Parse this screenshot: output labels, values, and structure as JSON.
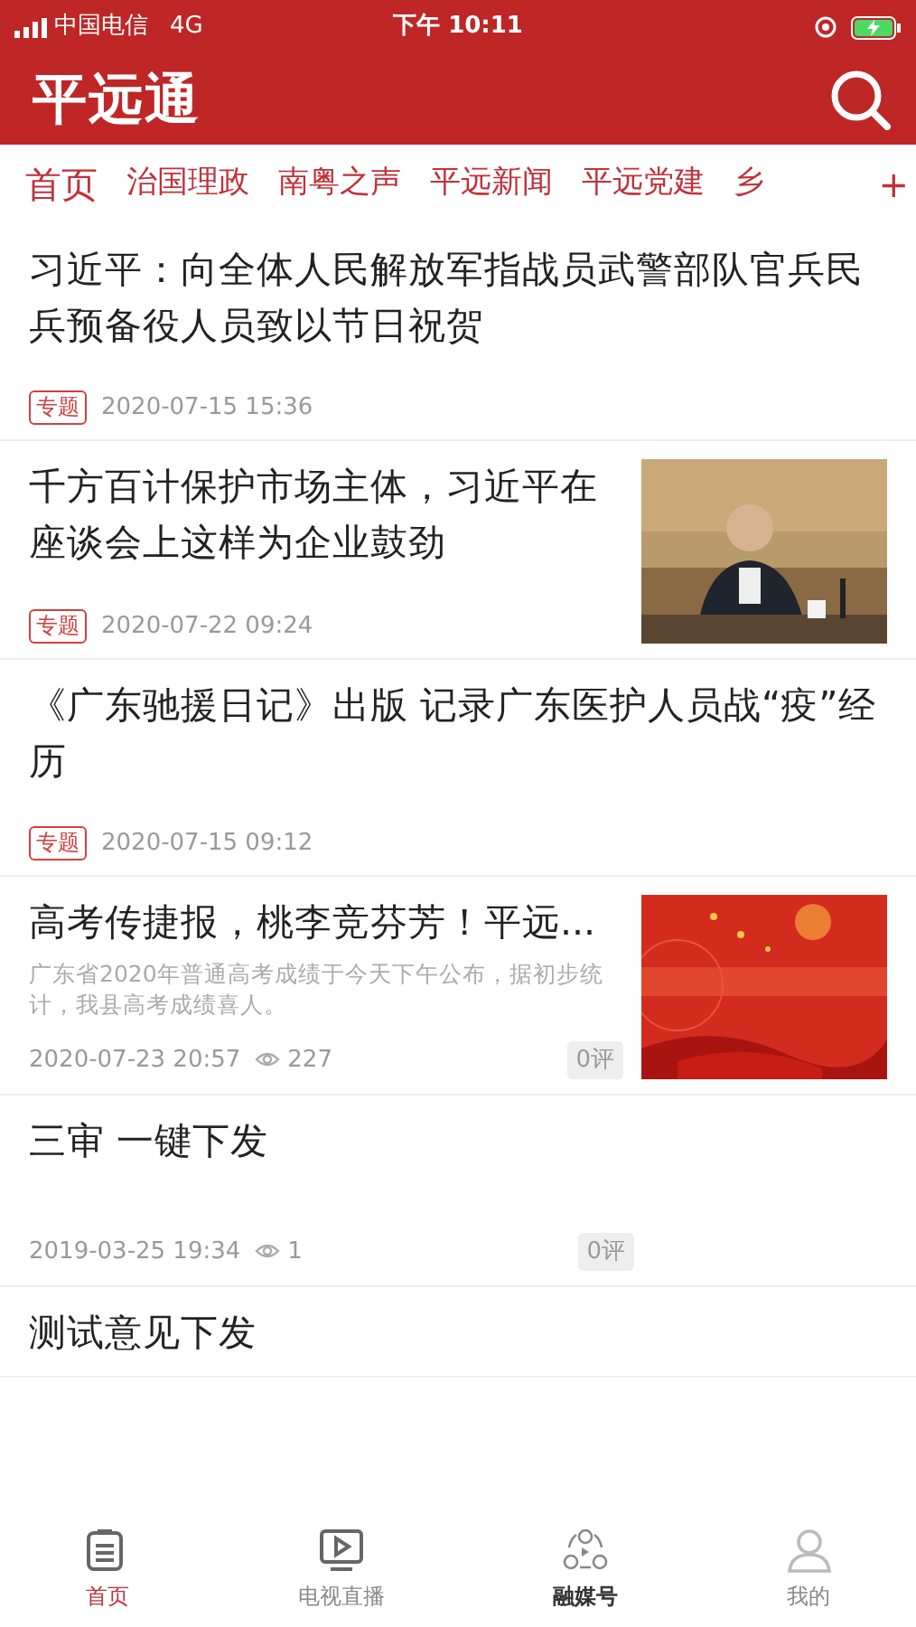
{
  "status_bar": {
    "carrier": "中国电信",
    "network": "4G",
    "time": "下午 10:11"
  },
  "header": {
    "title": "平远通"
  },
  "tabs": [
    {
      "label": "首页",
      "selected": true
    },
    {
      "label": "治国理政",
      "selected": false
    },
    {
      "label": "南粤之声",
      "selected": false
    },
    {
      "label": "平远新闻",
      "selected": false
    },
    {
      "label": "平远党建",
      "selected": false
    },
    {
      "label": "乡",
      "selected": false
    }
  ],
  "add_tab": "+",
  "articles": [
    {
      "kind": "tagged",
      "title": "习近平：向全体人民解放军指战员武警部队官兵民兵预备役人员致以节日祝贺",
      "tag": "专题",
      "date": "2020-07-15 15:36"
    },
    {
      "kind": "tagged",
      "title": "千方百计保护市场主体，习近平在座谈会上这样为企业鼓劲",
      "tag": "专题",
      "date": "2020-07-22 09:24"
    },
    {
      "kind": "tagged",
      "title": "《广东驰援日记》出版 记录广东医护人员战“疫”经历",
      "tag": "专题",
      "date": "2020-07-15 09:12"
    },
    {
      "kind": "stats",
      "title": "高考传捷报，桃李竞芬芳！平远...",
      "summary": "广东省2020年普通高考成绩于今天下午公布，据初步统计，我县高考成绩喜人。",
      "date": "2020-07-23 20:57",
      "views": "227",
      "comments": "0评"
    },
    {
      "kind": "stats",
      "title": "三审 一键下发",
      "date": "2019-03-25 19:34",
      "views": "1",
      "comments": "0评"
    },
    {
      "kind": "plain",
      "title": "测试意见下发"
    }
  ],
  "bottom_nav": [
    {
      "label": "首页",
      "selected": true,
      "bold": false
    },
    {
      "label": "电视直播",
      "selected": false,
      "bold": false
    },
    {
      "label": "融媒号",
      "selected": false,
      "bold": true
    },
    {
      "label": "我的",
      "selected": false,
      "bold": false
    }
  ]
}
